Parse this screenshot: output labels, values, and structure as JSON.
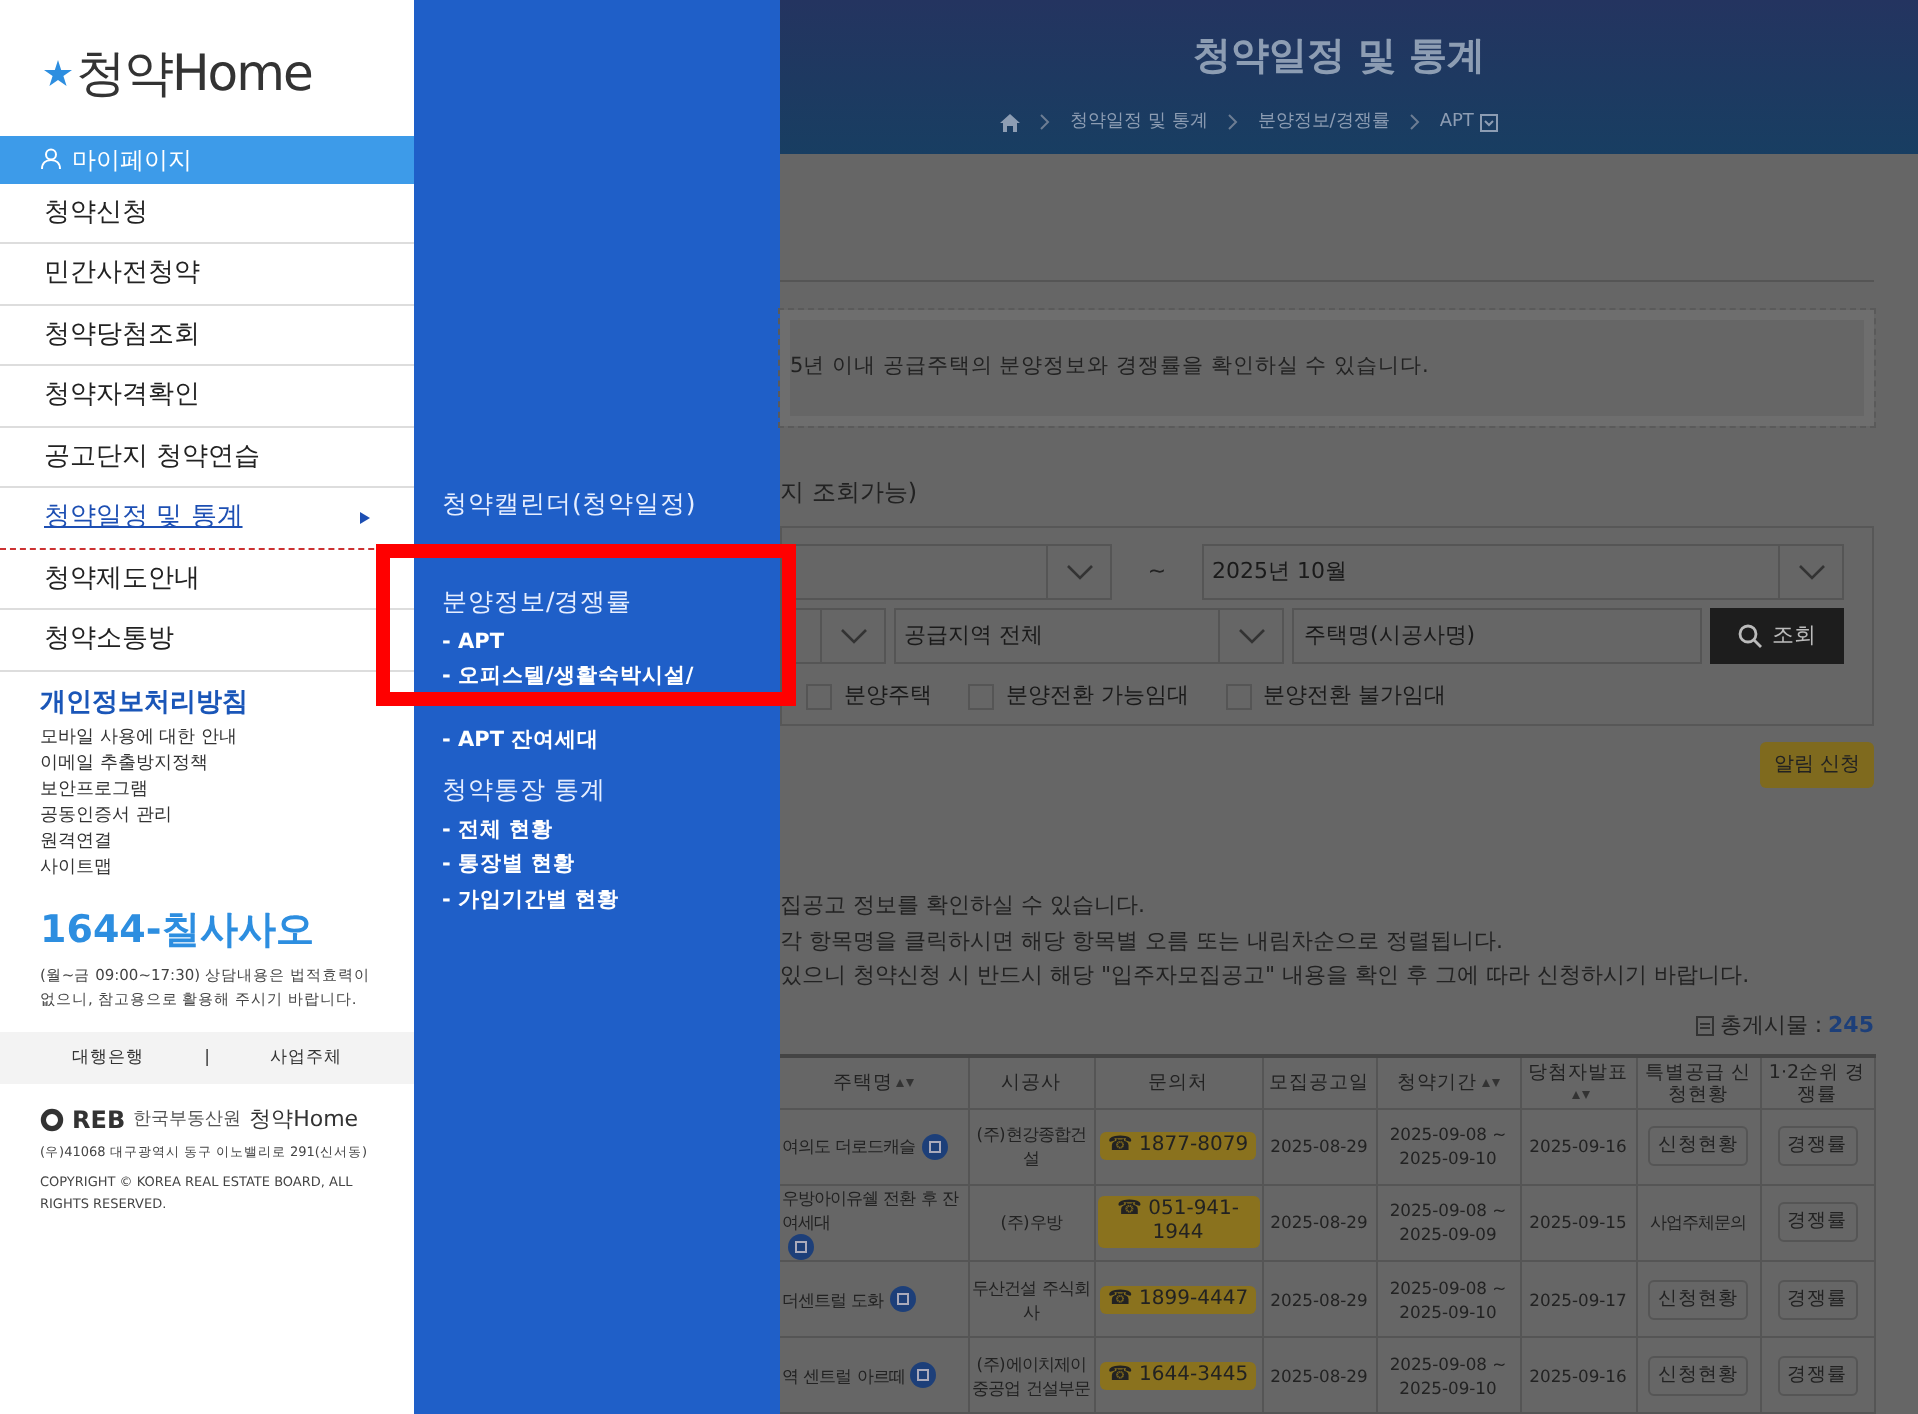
{
  "logo": {
    "text": "청약Home"
  },
  "sidebar": {
    "mypage": "마이페이지",
    "items": [
      {
        "label": "청약신청",
        "selected": false
      },
      {
        "label": "민간사전청약",
        "selected": false
      },
      {
        "label": "청약당첨조회",
        "selected": false
      },
      {
        "label": "청약자격확인",
        "selected": false
      },
      {
        "label": "공고단지 청약연습",
        "selected": false
      },
      {
        "label": "청약일정 및 통계",
        "selected": true
      },
      {
        "label": "청약제도안내",
        "selected": false
      },
      {
        "label": "청약소통방",
        "selected": false
      }
    ],
    "policy_title": "개인정보처리방침",
    "links": [
      "모바일 사용에 대한 안내",
      "이메일 추출방지정책",
      "보안프로그램",
      "공동인증서 관리",
      "원격연결",
      "사이트맵"
    ],
    "phone": "1644-칠사사오",
    "hours_note": "(월~금 09:00~17:30) 상담내용은 법적효력이 없으니, 참고용으로 활용해 주시기 바랍니다.",
    "footer_links": [
      "대행은행",
      "사업주체"
    ],
    "footer_separator": "|",
    "org": {
      "logo": "REB",
      "name": "한국부동산원",
      "brand": "청약Home",
      "address": "(우)41068 대구광역시 동구 이노밸리로 291(신서동)",
      "copyright": "COPYRIGHT © KOREA REAL ESTATE BOARD, ALL RIGHTS RESERVED."
    }
  },
  "flyout": {
    "groups": [
      {
        "title": "청약캘린더(청약일정)"
      },
      {
        "title": "분양정보/경쟁률",
        "items": [
          "- APT",
          "- 오피스텔/생활숙박시설/",
          "- APT 잔여세대"
        ]
      },
      {
        "title": "청약통장 통계",
        "items": [
          "- 전체 현황",
          "- 통장별 현황",
          "- 가입기간별 현황"
        ]
      }
    ]
  },
  "header": {
    "title": "청약일정 및 통계",
    "breadcrumb": [
      "청약일정 및 통계",
      "분양정보/경쟁률",
      "APT"
    ]
  },
  "notice": "5년 이내 공급주택의 분양정보와 경쟁률을 확인하실 수 있습니다.",
  "period_label": "지 조회가능)",
  "filters": {
    "period_end": "2025년 10월",
    "separator": "~",
    "region": "공급지역 전체",
    "search_placeholder": "주택명(시공사명)",
    "search_button": "조회"
  },
  "checkboxes": [
    {
      "label": "분양주택",
      "checked": false
    },
    {
      "label": "분양전환 가능임대",
      "checked": false
    },
    {
      "label": "분양전환 불가임대",
      "checked": false
    }
  ],
  "alert_button": "알림 신청",
  "guides": [
    "집공고 정보를 확인하실 수 있습니다.",
    "각 항목명을 클릭하시면 해당 항목별 오름 또는 내림차순으로 정렬됩니다.",
    "있으니 청약신청 시 반드시 해당 \"입주자모집공고\" 내용을 확인 후 그에 따라 신청하시기 바랍니다."
  ],
  "total": {
    "label": "총게시물 :",
    "count": "245"
  },
  "table": {
    "columns": [
      {
        "label": "주택명",
        "sortable": true
      },
      {
        "label": "시공사",
        "sortable": false
      },
      {
        "label": "문의처",
        "sortable": false
      },
      {
        "label": "모집공고일",
        "sortable": false
      },
      {
        "label": "청약기간",
        "sortable": true
      },
      {
        "label": "당첨자발표",
        "sortable": true
      },
      {
        "label": "특별공급 신청현황",
        "sortable": false
      },
      {
        "label": "1·2순위 경쟁률",
        "sortable": false
      }
    ],
    "rows": [
      {
        "name": "여의도 더로드캐슬",
        "builder": "(주)현강종합건설",
        "contact": "☎ 1877-8079",
        "notice_date": "2025-08-29",
        "period": "2025-09-08 ~ 2025-09-10",
        "winner_date": "2025-09-16",
        "special": {
          "kind": "button",
          "text": "신청현황"
        },
        "rank": "경쟁률"
      },
      {
        "name": "우방아이유쉘 전환 후 잔여세대",
        "builder": "(주)우방",
        "contact": "☎ 051-941-1944",
        "notice_date": "2025-08-29",
        "period": "2025-09-08 ~ 2025-09-09",
        "winner_date": "2025-09-15",
        "special": {
          "kind": "text",
          "text": "사업주체문의"
        },
        "rank": "경쟁률"
      },
      {
        "name": "더센트럴 도화",
        "builder": "두산건설 주식회사",
        "contact": "☎ 1899-4447",
        "notice_date": "2025-08-29",
        "period": "2025-09-08 ~ 2025-09-10",
        "winner_date": "2025-09-17",
        "special": {
          "kind": "button",
          "text": "신청현황"
        },
        "rank": "경쟁률"
      },
      {
        "name": "역 센트럴 아르떼",
        "builder": "(주)에이치제이중공업 건설부문",
        "contact": "☎ 1644-3445",
        "notice_date": "2025-08-29",
        "period": "2025-09-08 ~ 2025-09-10",
        "winner_date": "2025-09-16",
        "special": {
          "kind": "button",
          "text": "신청현황"
        },
        "rank": "경쟁률"
      }
    ]
  }
}
